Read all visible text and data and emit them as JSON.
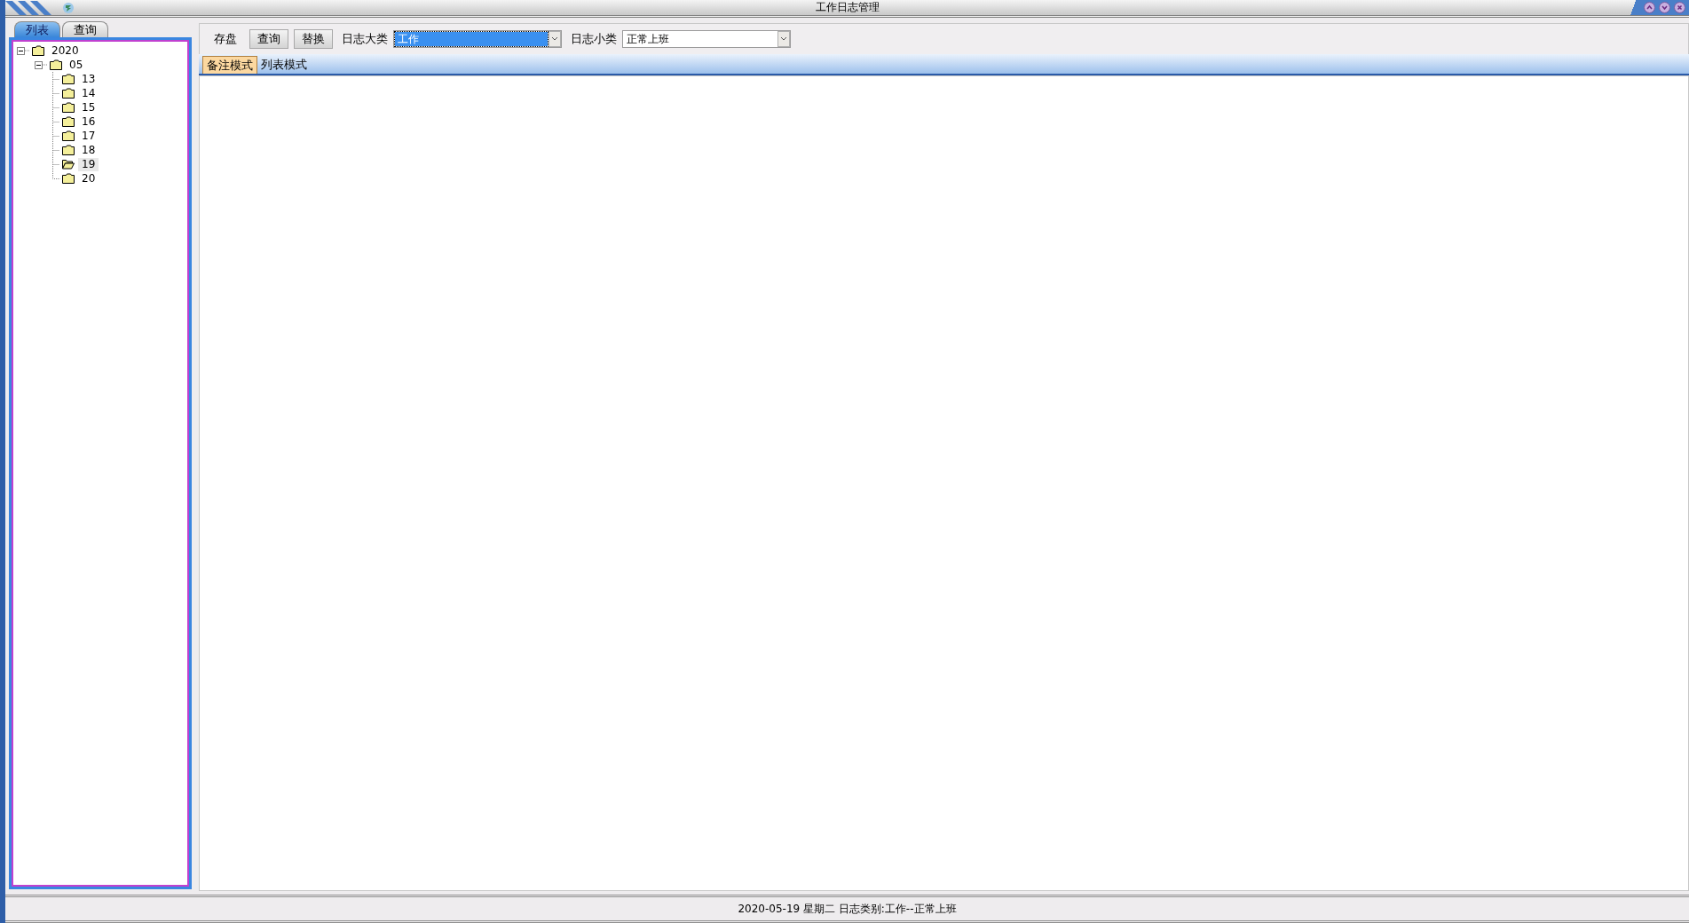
{
  "window": {
    "title": "工作日志管理"
  },
  "side_tabs": [
    {
      "label": "列表",
      "selected": true
    },
    {
      "label": "查询",
      "selected": false
    }
  ],
  "tree": [
    {
      "label": "2020",
      "expanded": true,
      "selected": false,
      "children": [
        {
          "label": "05",
          "expanded": true,
          "selected": false,
          "children": [
            {
              "label": "13",
              "selected": false
            },
            {
              "label": "14",
              "selected": false
            },
            {
              "label": "15",
              "selected": false
            },
            {
              "label": "16",
              "selected": false
            },
            {
              "label": "17",
              "selected": false
            },
            {
              "label": "18",
              "selected": false
            },
            {
              "label": "19",
              "selected": true
            },
            {
              "label": "20",
              "selected": false
            }
          ]
        }
      ]
    }
  ],
  "toolbar": {
    "buttons": [
      {
        "kind": "flat",
        "label": "存盘"
      },
      {
        "kind": "raised",
        "label": "查询"
      },
      {
        "kind": "raised",
        "label": "替换"
      }
    ],
    "combos": [
      {
        "label": "日志大类",
        "value": "工作",
        "highlighted": true
      },
      {
        "label": "日志小类",
        "value": "正常上班",
        "highlighted": false
      }
    ]
  },
  "mode_tabs": [
    {
      "label": "备注模式",
      "selected": true
    },
    {
      "label": "列表模式",
      "selected": false
    }
  ],
  "status_bar": "2020-05-19 星期二 日志类别:工作--正常上班"
}
